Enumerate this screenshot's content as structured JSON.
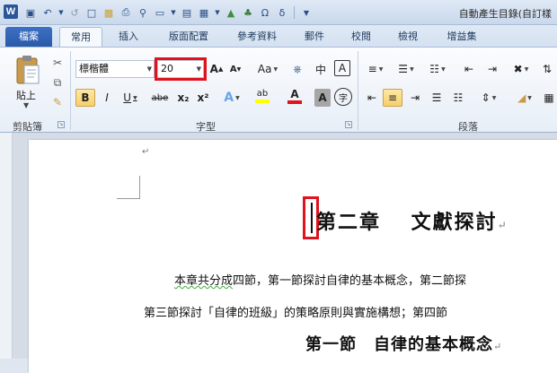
{
  "app": {
    "logo_letter": "W",
    "title": "自動產生目錄(自訂樣"
  },
  "tabs": {
    "file": "檔案",
    "items": [
      "常用",
      "插入",
      "版面配置",
      "參考資料",
      "郵件",
      "校閱",
      "檢視",
      "增益集"
    ],
    "active_index": 0
  },
  "ribbon": {
    "clipboard": {
      "paste_label": "貼上",
      "group_label": "剪貼簿"
    },
    "font": {
      "font_name": "標楷體",
      "font_size": "20",
      "case_label": "Aa",
      "group_label": "字型",
      "bold": "B",
      "italic": "I",
      "underline": "U",
      "strike": "abe",
      "subscript": "x₂",
      "superscript": "x²",
      "phonetic": "中",
      "char_border": "A",
      "highlight": "ab",
      "font_color": "A",
      "char_shade": "A",
      "enclose": "字"
    },
    "paragraph": {
      "group_label": "段落"
    }
  },
  "document": {
    "chapter_title": "第二章　 文獻探討",
    "line1": "本章共分成四節，第一節探討自律的基本概念，第二節探",
    "line1_squiggle": "本章共分成",
    "line1_rest": "四節，第一節探討自律的基本概念，第二節探",
    "line2": "第三節探討「自律的班級」的策略原則與實施構想；第四節",
    "section_title": "第一節　自律的基本概念",
    "para_mark": "↵"
  },
  "colors": {
    "highlight_box": "#e0121c",
    "file_tab": "#2a5aa8",
    "font_color_bar": "#e0121c",
    "highlight_bar": "#ffff00"
  }
}
